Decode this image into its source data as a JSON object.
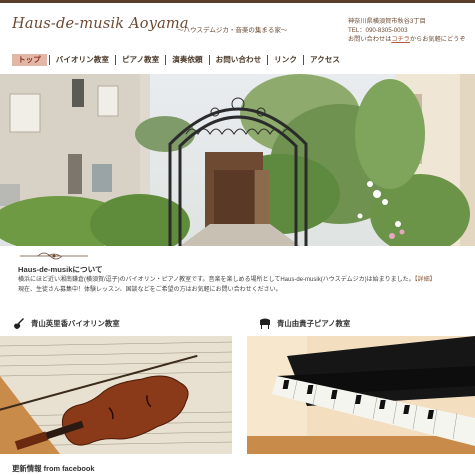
{
  "header": {
    "logo": "Haus-de-musik Aoyama",
    "tagline": "〜ハウスデムジカ・音楽の集まる家〜",
    "address": "神奈川県横須賀市秋谷3丁目",
    "phone": "TEL：090-8305-0003",
    "contact_prefix": "お問い合わせは",
    "contact_link": "コチラ",
    "contact_suffix": "からお気軽にどうぞ"
  },
  "nav": {
    "items": [
      {
        "label": "トップ",
        "active": true
      },
      {
        "label": "バイオリン教室"
      },
      {
        "label": "ピアノ教室"
      },
      {
        "label": "演奏依頼"
      },
      {
        "label": "お問い合わせ"
      },
      {
        "label": "リンク"
      },
      {
        "label": "アクセス"
      }
    ]
  },
  "about": {
    "title": "Haus-de-musikについて",
    "line1": "横浜にほど近い湘南鎌倉(横須賀/逗子)のバイオリン・ピアノ教室です。音楽を楽しめる場所としてHaus-de-musik(ハウスデムジカ)は始まりました。",
    "detail_link": "【詳細】",
    "line2": "現在、生徒さん募集中！体験レッスン、国談などをご希望の方はお気軽にお問い合わせください。"
  },
  "sections": {
    "violin": "青山英里香バイオリン教室",
    "piano": "青山由貴子ピアノ教室"
  },
  "news": {
    "title": "更新情報 from facebook"
  }
}
